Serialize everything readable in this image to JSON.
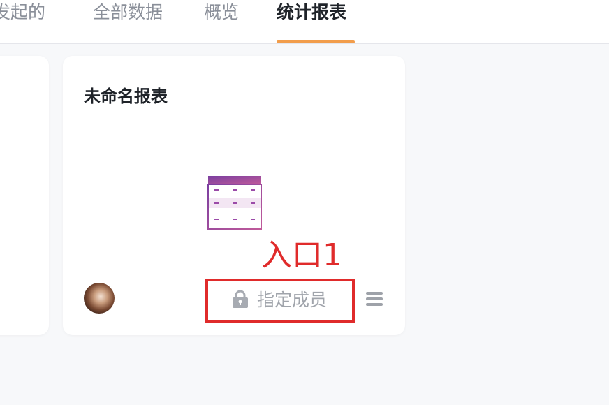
{
  "tabs": [
    {
      "label": "发起的"
    },
    {
      "label": "全部数据"
    },
    {
      "label": "概览"
    },
    {
      "label": "统计报表"
    }
  ],
  "active_tab": "统计报表",
  "report_card": {
    "title": "未命名报表",
    "icon": "table-grid-icon",
    "permission_label": "指定成员",
    "permission_icon": "lock-icon",
    "menu_icon": "hamburger-menu-icon"
  },
  "annotation": {
    "label": "入口1",
    "color": "#e02b2b"
  },
  "colors": {
    "accent": "#f29d4b",
    "icon_purple": "#8e44ad",
    "icon_pink": "#c05a9a"
  }
}
